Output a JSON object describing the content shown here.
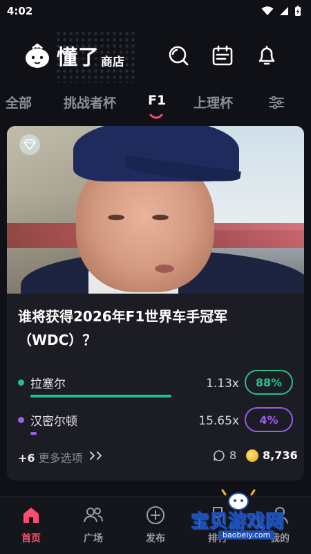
{
  "status": {
    "time": "4:02"
  },
  "header": {
    "brand": "懂了",
    "sub": "商店"
  },
  "tabs": [
    {
      "label": "全部"
    },
    {
      "label": "挑战者杯"
    },
    {
      "label": "F1",
      "active": true
    },
    {
      "label": "上理杯"
    }
  ],
  "card": {
    "question": "谁将获得2026年F1世界车手冠军（WDC）？",
    "options": [
      {
        "name": "拉塞尔",
        "odds": "1.13x",
        "percent": "88%",
        "percent_value": 88,
        "color": "#22c28a"
      },
      {
        "name": "汉密尔顿",
        "odds": "15.65x",
        "percent": "4%",
        "percent_value": 4,
        "color": "#9b5cf0"
      }
    ],
    "more_count": "+6",
    "more_label": "更多选项",
    "comments": "8",
    "coins": "8,736"
  },
  "nav": [
    {
      "label": "首页",
      "icon": "home-icon",
      "active": true
    },
    {
      "label": "广场",
      "icon": "people-icon"
    },
    {
      "label": "发布",
      "icon": "plus-circle-icon"
    },
    {
      "label": "排行",
      "icon": "trophy-icon"
    },
    {
      "label": "我的",
      "icon": "user-icon"
    }
  ],
  "watermark": {
    "text": "宝贝游戏网",
    "url": "baobeiy.com"
  },
  "colors": {
    "accent": "#ff4d6d",
    "green": "#22c28a",
    "purple": "#9b5cf0",
    "background": "#101117"
  }
}
